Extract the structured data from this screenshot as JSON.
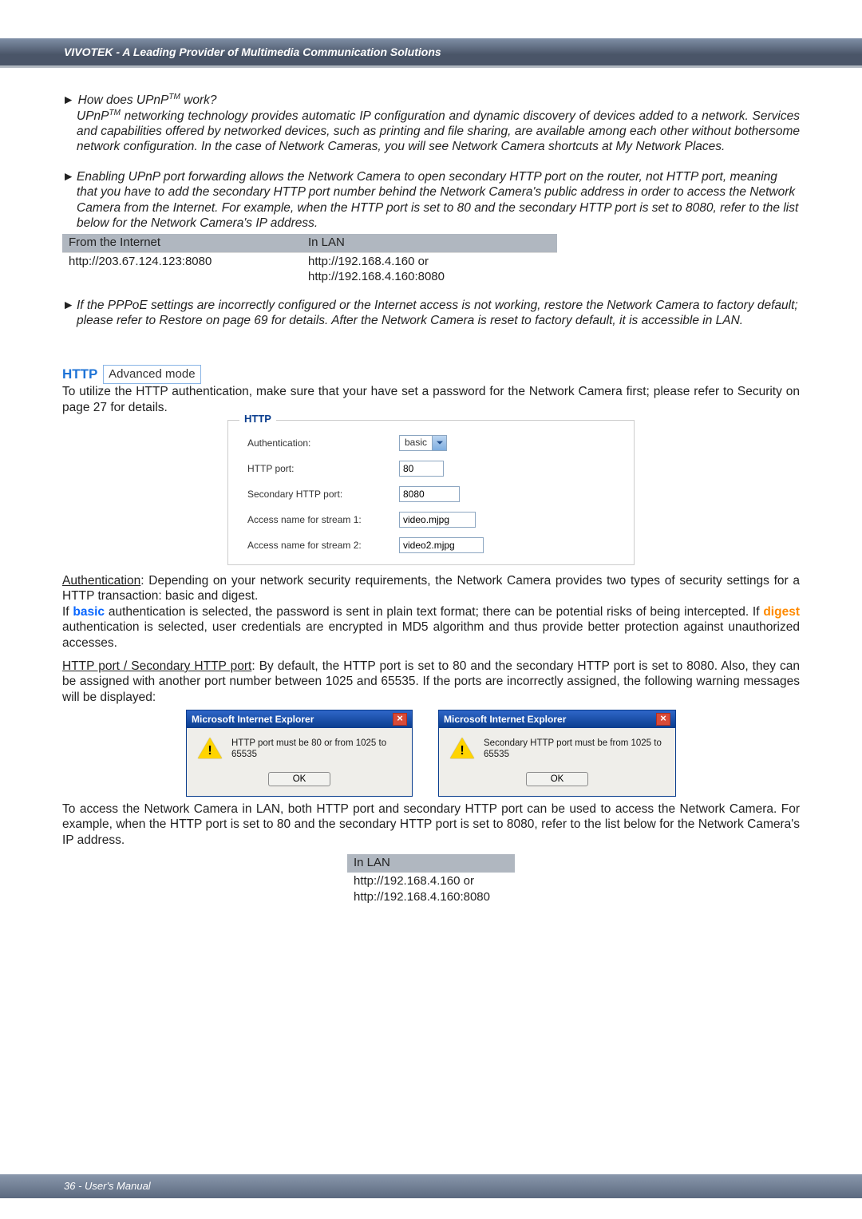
{
  "banner": "VIVOTEK - A Leading Provider of Multimedia Communication Solutions",
  "q1": {
    "prefix": "► How does UPnP",
    "sup": "TM",
    "suffix": " work?",
    "body_p": "UPnP",
    "body_sup": "TM",
    "body": " networking technology provides automatic IP configuration and dynamic discovery of devices added to a network. Services and capabilities offered by networked devices, such as printing and file sharing, are available among each other without bothersome network configuration. In the case of Network Cameras, you will see Network Camera shortcuts at My Network Places."
  },
  "q2": {
    "bullet": "►",
    "body": "Enabling UPnP port forwarding allows the Network Camera to open secondary HTTP port on the router, not HTTP port, meaning that you have to add the secondary HTTP port number behind the Network Camera's public address in order to access the Network Camera from the Internet. For example, when the HTTP port is set to 80 and the secondary HTTP port is set to 8080, refer to the list below for the Network Camera's IP address."
  },
  "table1": {
    "h1": "From the Internet",
    "h2": "In LAN",
    "c1": "http://203.67.124.123:8080",
    "c2a": "http://192.168.4.160 or",
    "c2b": "http://192.168.4.160:8080"
  },
  "q3": {
    "bullet": "►",
    "body": "If the PPPoE settings are incorrectly configured or the Internet access is not working, restore the Network Camera to factory default; please refer to Restore on page 69 for details. After the Network Camera is reset to factory default, it is accessible in LAN."
  },
  "http_section": {
    "title": "HTTP",
    "tag": "Advanced mode",
    "intro": "To utilize the HTTP authentication, make sure that your have set a password for the Network Camera first; please refer to Security on page 27 for details."
  },
  "form": {
    "legend": "HTTP",
    "rows": {
      "auth_lbl": "Authentication:",
      "auth_val": "basic",
      "httpport_lbl": "HTTP port:",
      "httpport_val": "80",
      "sec_lbl": "Secondary HTTP port:",
      "sec_val": "8080",
      "s1_lbl": "Access name for stream 1:",
      "s1_val": "video.mjpg",
      "s2_lbl": "Access name for stream 2:",
      "s2_val": "video2.mjpg"
    }
  },
  "auth_para": {
    "lead": "Authentication",
    "rest": ": Depending on your network security requirements, the Network Camera provides two types of security settings for a HTTP transaction: basic and digest.",
    "p2a": "If ",
    "basic": "basic",
    "p2b": " authentication is selected, the password is sent in plain text format; there can be potential risks of being intercepted. If ",
    "digest": "digest",
    "p2c": " authentication is selected, user credentials are encrypted in MD5 algorithm and thus provide better protection against unauthorized accesses."
  },
  "port_para": {
    "lead": "HTTP port / Secondary HTTP port",
    "rest": ": By default, the HTTP port is set to 80 and the secondary HTTP port is set to 8080. Also, they can be assigned with another port number between 1025 and 65535. If the ports are incorrectly assigned, the following warning messages will be displayed:"
  },
  "dialog": {
    "title": "Microsoft Internet Explorer",
    "close": "×",
    "msg1": "HTTP port must be 80 or from 1025 to 65535",
    "msg2": "Secondary HTTP port must be from 1025 to 65535",
    "ok": "OK"
  },
  "after_dialog": "To access the Network Camera in LAN, both HTTP port and secondary HTTP port can be used to access the Network Camera. For example, when the HTTP port is set to 80 and the secondary HTTP port is set to 8080, refer to the list below for the Network Camera's IP address.",
  "lan_table": {
    "h": "In LAN",
    "a": "http://192.168.4.160  or",
    "b": "http://192.168.4.160:8080"
  },
  "footer": "36 - User's Manual"
}
